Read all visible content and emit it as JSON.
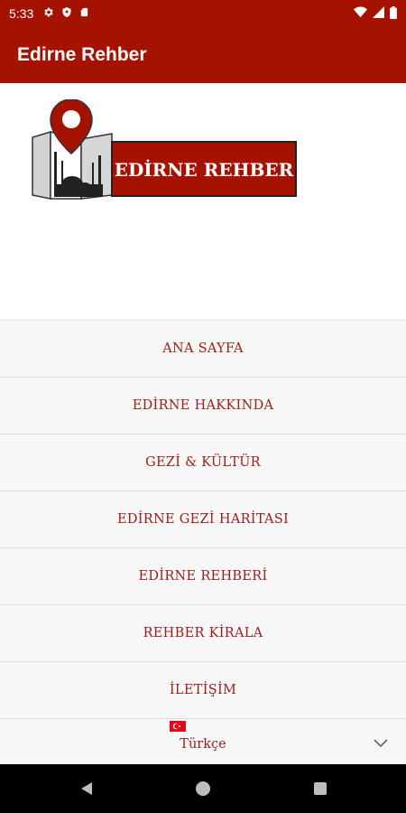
{
  "status_bar": {
    "time": "5:33",
    "icons_left": [
      "gear-icon",
      "shield-icon",
      "sd-card-icon"
    ],
    "icons_right": [
      "wifi-icon",
      "signal-icon",
      "battery-icon"
    ]
  },
  "app_bar": {
    "title": "Edirne Rehber"
  },
  "logo": {
    "text": "EDİRNE REHBER"
  },
  "menu": {
    "items": [
      {
        "label": "ANA SAYFA"
      },
      {
        "label": "EDİRNE HAKKINDA"
      },
      {
        "label": "GEZİ & KÜLTÜR"
      },
      {
        "label": "EDİRNE GEZİ HARİTASI"
      },
      {
        "label": "EDİRNE REHBERİ"
      },
      {
        "label": "REHBER KİRALA"
      },
      {
        "label": "İLETİŞİM"
      }
    ],
    "language": {
      "selected": "Türkçe",
      "flag": "turkey-flag-icon"
    }
  },
  "nav_bar": {
    "buttons": [
      "back-icon",
      "home-icon",
      "recents-icon"
    ]
  },
  "colors": {
    "brand": "#a51200",
    "menu_text": "#9c1c1c",
    "menu_bg": "#f7f7f7"
  }
}
